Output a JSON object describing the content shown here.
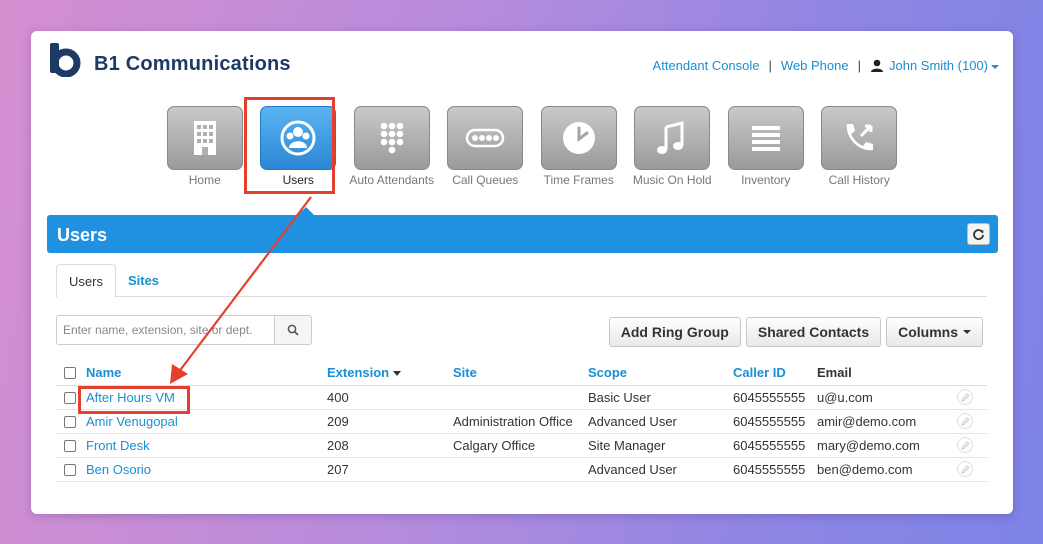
{
  "brand": {
    "name": "B1 Communications"
  },
  "top_links": {
    "attendant_console": "Attendant Console",
    "web_phone": "Web Phone",
    "separator": "|",
    "user": "John Smith (100)"
  },
  "nav": [
    {
      "label": "Home",
      "icon": "building-icon"
    },
    {
      "label": "Users",
      "icon": "users-icon",
      "active": true
    },
    {
      "label": "Auto Attendants",
      "icon": "keypad-icon"
    },
    {
      "label": "Call Queues",
      "icon": "dots-icon"
    },
    {
      "label": "Time Frames",
      "icon": "clock-icon"
    },
    {
      "label": "Music On Hold",
      "icon": "music-icon"
    },
    {
      "label": "Inventory",
      "icon": "list-icon"
    },
    {
      "label": "Call History",
      "icon": "call-history-icon"
    }
  ],
  "banner": {
    "title": "Users"
  },
  "tabs": [
    {
      "label": "Users",
      "active": true
    },
    {
      "label": "Sites",
      "active": false
    }
  ],
  "search": {
    "placeholder": "Enter name, extension, site or dept."
  },
  "actions": {
    "add_ring_group": "Add Ring Group",
    "shared_contacts": "Shared Contacts",
    "columns": "Columns"
  },
  "table": {
    "headers": [
      "Name",
      "Extension",
      "Site",
      "Scope",
      "Caller ID",
      "Email"
    ],
    "rows": [
      [
        "After Hours VM",
        "400",
        "",
        "Basic User",
        "6045555555",
        "u@u.com"
      ],
      [
        "Amir Venugopal",
        "209",
        "Administration Office",
        "Advanced User",
        "6045555555",
        "amir@demo.com"
      ],
      [
        "Front Desk",
        "208",
        "Calgary Office",
        "Site Manager",
        "6045555555",
        "mary@demo.com"
      ],
      [
        "Ben Osorio",
        "207",
        "",
        "Advanced User",
        "6045555555",
        "ben@demo.com"
      ]
    ]
  },
  "colors": {
    "accent": "#1f91e0",
    "link": "#1a8fd1",
    "highlight": "#e3402f",
    "brand": "#1d3a66"
  }
}
